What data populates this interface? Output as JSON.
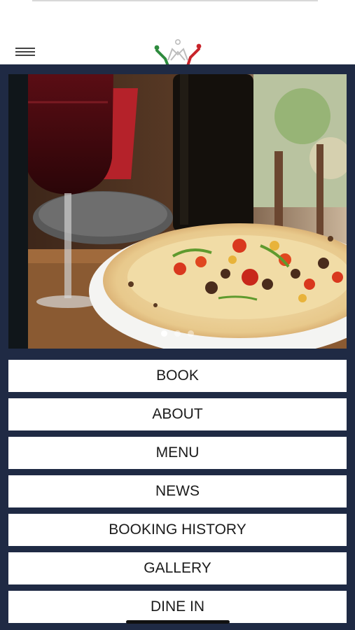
{
  "header": {
    "menu_icon": "hamburger-icon",
    "logo_icon": "crown-logo",
    "logo_colors": [
      "#2e8b3e",
      "#bdbdbd",
      "#c8242b"
    ]
  },
  "carousel": {
    "slide_count": 3,
    "active_index": 0
  },
  "menu": {
    "items": [
      {
        "label": "BOOK"
      },
      {
        "label": "ABOUT"
      },
      {
        "label": "MENU"
      },
      {
        "label": "NEWS"
      },
      {
        "label": "BOOKING HISTORY"
      },
      {
        "label": "GALLERY"
      },
      {
        "label": "DINE IN"
      }
    ]
  },
  "colors": {
    "panel_background": "#1f2a44",
    "button_background": "#ffffff",
    "button_text": "#1b1b1b"
  }
}
